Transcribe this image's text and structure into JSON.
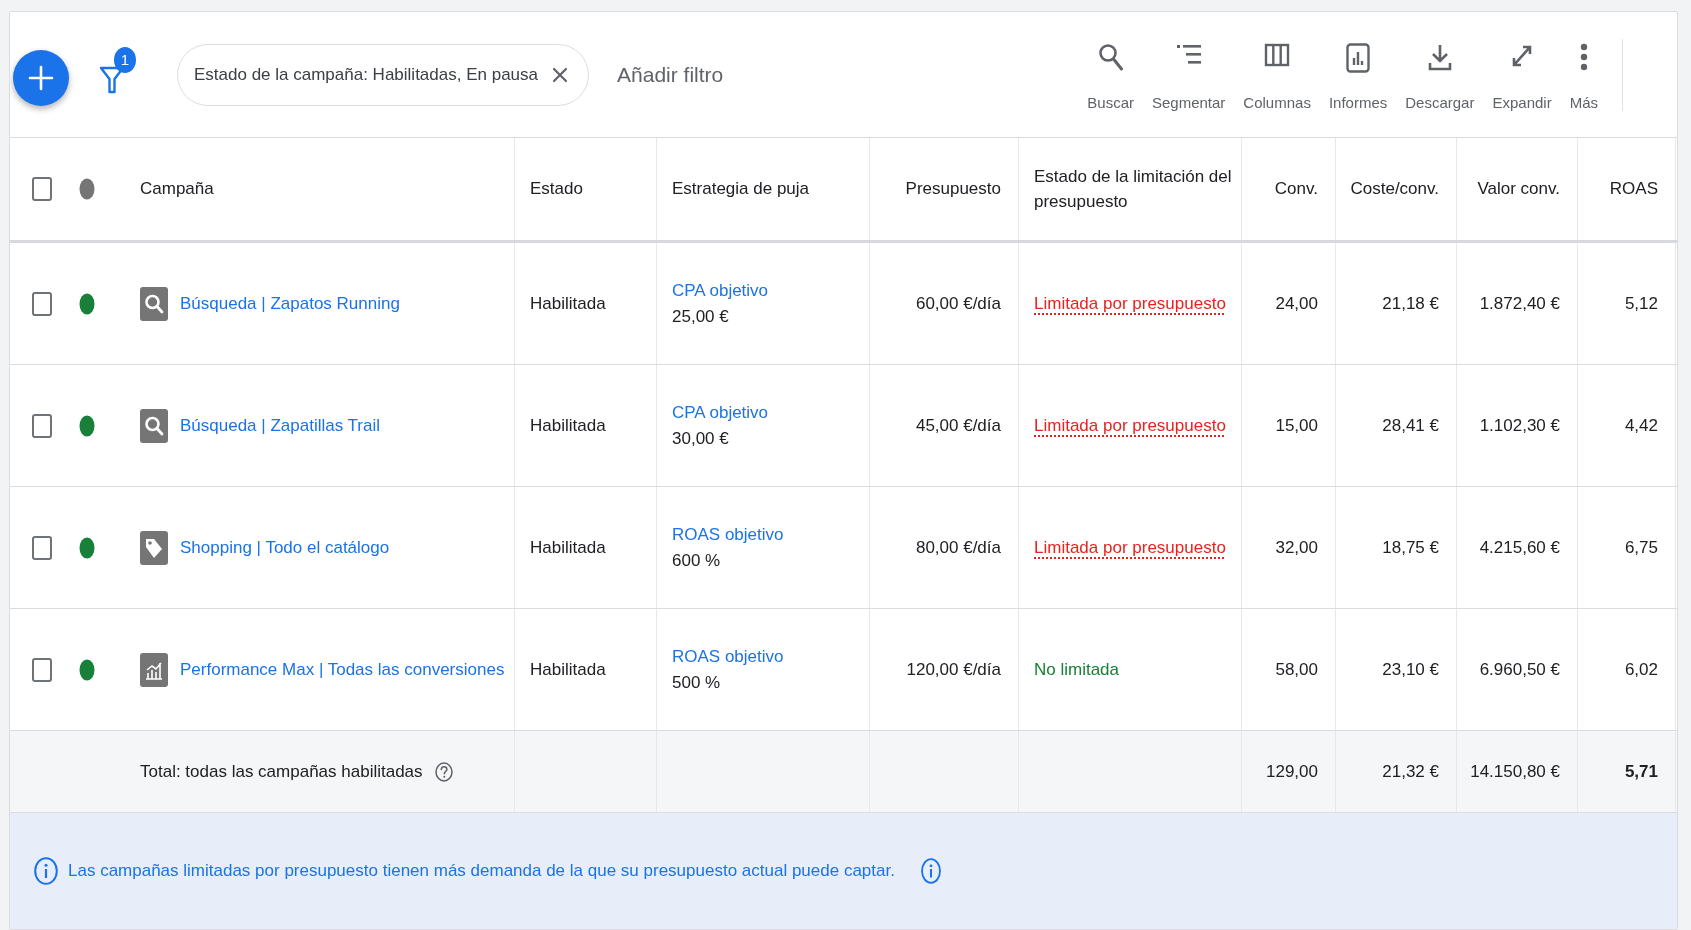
{
  "toolbar": {
    "filter_badge": "1",
    "filter_chip": {
      "label": "Estado de la campaña: Habilitadas, En pausa"
    },
    "add_filter": "Añadir filtro",
    "actions": [
      {
        "kind": "search",
        "label": "Buscar"
      },
      {
        "kind": "segment",
        "label": "Segmentar"
      },
      {
        "kind": "columns",
        "label": "Columnas"
      },
      {
        "kind": "reports",
        "label": "Informes"
      },
      {
        "kind": "download",
        "label": "Descargar"
      },
      {
        "kind": "expand",
        "label": "Expandir"
      },
      {
        "kind": "more",
        "label": "Más"
      }
    ]
  },
  "table": {
    "select_all": {
      "checked": false
    },
    "columns": [
      {
        "label": "Campaña",
        "kind": "text"
      },
      {
        "label": "Estado",
        "kind": "text"
      },
      {
        "label": "Estrategia de puja",
        "kind": "text"
      },
      {
        "label": "Presupuesto",
        "kind": "number"
      },
      {
        "label": "Estado de la limitación del presupuesto",
        "kind": "text"
      },
      {
        "label": "Conv.",
        "kind": "number"
      },
      {
        "label": "Coste/conv.",
        "kind": "number"
      },
      {
        "label": "Valor conv.",
        "kind": "number"
      },
      {
        "label": "ROAS",
        "kind": "number"
      }
    ],
    "rows": [
      {
        "checked": false,
        "color": "#188038",
        "kind": "search",
        "name": "Búsqueda | Zapatos Running",
        "status": "Habilitada",
        "bid_strategy": "CPA objetivo",
        "bid_target": "25,00 €",
        "budget": "60,00 €/día",
        "budget_limit": {
          "label": "Limitada por presupuesto",
          "limited": true
        },
        "conv": "24,00",
        "cost_per_conv": "21,18 €",
        "conv_value": "1.872,40 €",
        "roas": "5,12"
      },
      {
        "checked": false,
        "color": "#188038",
        "kind": "search",
        "name": "Búsqueda | Zapatillas Trail",
        "status": "Habilitada",
        "bid_strategy": "CPA objetivo",
        "bid_target": "30,00 €",
        "budget": "45,00 €/día",
        "budget_limit": {
          "label": "Limitada por presupuesto",
          "limited": true
        },
        "conv": "15,00",
        "cost_per_conv": "28,41 €",
        "conv_value": "1.102,30 €",
        "roas": "4,42"
      },
      {
        "checked": false,
        "color": "#188038",
        "kind": "shopping",
        "name": "Shopping | Todo el catálogo",
        "status": "Habilitada",
        "bid_strategy": "ROAS objetivo",
        "bid_target": "600 %",
        "budget": "80,00 €/día",
        "budget_limit": {
          "label": "Limitada por presupuesto",
          "limited": true
        },
        "conv": "32,00",
        "cost_per_conv": "18,75 €",
        "conv_value": "4.215,60 €",
        "roas": "6,75"
      },
      {
        "checked": false,
        "color": "#188038",
        "kind": "performance_max",
        "name": "Performance Max | Todas las conversiones",
        "status": "Habilitada",
        "bid_strategy": "ROAS objetivo",
        "bid_target": "500 %",
        "budget": "120,00 €/día",
        "budget_limit": {
          "label": "No limitada",
          "limited": false
        },
        "conv": "58,00",
        "cost_per_conv": "23,10 €",
        "conv_value": "6.960,50 €",
        "roas": "6,02"
      }
    ],
    "total": {
      "label": "Total: todas las campañas habilitadas",
      "conv": "129,00",
      "cost_per_conv": "21,32 €",
      "conv_value": "14.150,80 €",
      "roas": "5,71"
    }
  },
  "info_banner": {
    "text": "Las campañas limitadas por presupuesto tienen más demanda de la que su presupuesto actual puede captar."
  }
}
